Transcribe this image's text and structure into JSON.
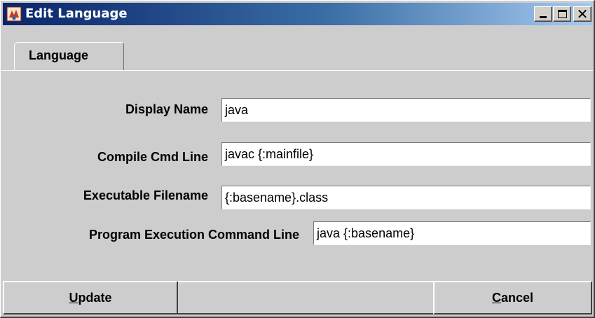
{
  "window": {
    "title": "Edit Language",
    "icon": "app-icon",
    "controls": {
      "minimize": "minimize-icon",
      "maximize": "maximize-icon",
      "close": "close-icon",
      "close_glyph": "✕"
    }
  },
  "tabs": [
    {
      "label": "Language",
      "selected": true
    }
  ],
  "form": {
    "display_name": {
      "label": "Display Name",
      "value": "java"
    },
    "compile_cmd": {
      "label": "Compile Cmd Line",
      "value": "javac {:mainfile}"
    },
    "executable": {
      "label": "Executable Filename",
      "value": "{:basename}.class"
    },
    "program_exec": {
      "label": "Program Execution Command Line",
      "value": "java {:basename}"
    }
  },
  "buttons": {
    "update": {
      "mnemonic": "U",
      "rest": "pdate"
    },
    "cancel": {
      "mnemonic": "C",
      "rest": "ancel"
    }
  }
}
